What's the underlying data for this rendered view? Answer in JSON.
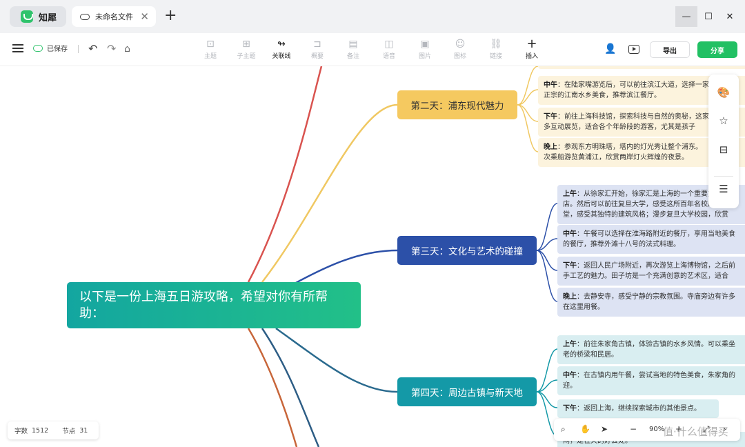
{
  "app": {
    "name": "知犀",
    "doc_title": "未命名文件"
  },
  "window": {
    "minimize": "—",
    "maximize": "☐",
    "close": "✕",
    "new_tab": "+",
    "tab_close": "✕"
  },
  "toolbar": {
    "saved": "已保存",
    "undo": "↶",
    "redo": "↷",
    "format": "⌂",
    "tools": [
      {
        "label": "主题",
        "icon": "⊡"
      },
      {
        "label": "子主题",
        "icon": "⊞"
      },
      {
        "label": "关联线",
        "icon": "↬"
      },
      {
        "label": "概要",
        "icon": "⊐"
      },
      {
        "label": "备注",
        "icon": "▤"
      },
      {
        "label": "语音",
        "icon": "◫"
      },
      {
        "label": "图片",
        "icon": "▣"
      },
      {
        "label": "图标",
        "icon": "☺"
      },
      {
        "label": "链接",
        "icon": "⛓"
      },
      {
        "label": "插入",
        "icon": "+"
      }
    ],
    "people_icon": "👤",
    "export_label": "导出",
    "share_label": "分享"
  },
  "mindmap": {
    "root": "以下是一份上海五日游攻略，希望对你有所帮助：",
    "branches": [
      {
        "title": "第二天：浦东现代魅力",
        "leaves": [
          {
            "key": "中午",
            "lines": [
              "：在陆家嘴游览后，可以前往滨江大道，选择一家餐",
              "正宗的江南水乡美食，推荐滨江餐厅。"
            ]
          },
          {
            "key": "下午",
            "lines": [
              "：前往上海科技馆，探索科技与自然的奥秘，这家",
              "多互动展览，适合各个年龄段的游客，尤其是孩子"
            ]
          },
          {
            "key": "晚上",
            "lines": [
              "：参观东方明珠塔，塔内的灯光秀让整个浦东。",
              "次乘船游览黄浦江，欣赏两岸灯火辉煌的夜景。"
            ]
          }
        ]
      },
      {
        "title": "第三天：文化与艺术的碰撞",
        "leaves": [
          {
            "key": "上午",
            "lines": [
              "：从徐家汇开始，徐家汇是上海的一个重要文化",
              "店。然后可以前往复旦大学，感受这所百年名校的文化",
              "堂，感受其独特的建筑风格；漫步复旦大学校园，欣赏"
            ]
          },
          {
            "key": "中午",
            "lines": [
              "：午餐可以选择在淮海路附近的餐厅，享用当地美食",
              "的餐厅，推荐外滩十八号的法式料理。"
            ]
          },
          {
            "key": "下午",
            "lines": [
              "：返回人民广场附近，再次游览上海博物馆，之后前",
              "手工艺的魅力。田子坊是一个充满创意的艺术区，适合"
            ]
          },
          {
            "key": "晚上",
            "lines": [
              "：去静安寺，感受宁静的宗教氛围。寺庙旁边有许多",
              "在这里用餐。"
            ]
          }
        ]
      },
      {
        "title": "第四天：周边古镇与新天地",
        "leaves": [
          {
            "key": "上午",
            "lines": [
              "：前往朱家角古镇，体验古镇的水乡风情。可以乘坐",
              "老的桥梁和民居。"
            ]
          },
          {
            "key": "中午",
            "lines": [
              "：在古镇内用午餐，尝试当地的特色美食，朱家角的",
              "迎。"
            ]
          },
          {
            "key": "下午",
            "lines": [
              "：返回上海，继续探索城市的其他景点。"
            ]
          },
          {
            "key": "",
            "lines": [
              "闹，是在天的好去处。"
            ]
          }
        ]
      }
    ]
  },
  "right_panel": {
    "icons": [
      "🎨",
      "☆",
      "⊟",
      "☰"
    ]
  },
  "stats": {
    "words_label": "字数",
    "words_value": "1512",
    "nodes_label": "节点",
    "nodes_value": "31"
  },
  "zoom": {
    "search": "⌕",
    "hand": "✋",
    "pointer": "➤",
    "minus": "−",
    "value": "90%",
    "plus": "+",
    "fit": "⤢",
    "more": "›"
  },
  "watermark": "值·什么值得买",
  "colors": {
    "accent_green": "#21c063",
    "branch2": "#f5c960",
    "branch3": "#2c50a8",
    "branch4": "#1499a7",
    "line_red": "#d9534f",
    "line_orange": "#c8663a"
  }
}
